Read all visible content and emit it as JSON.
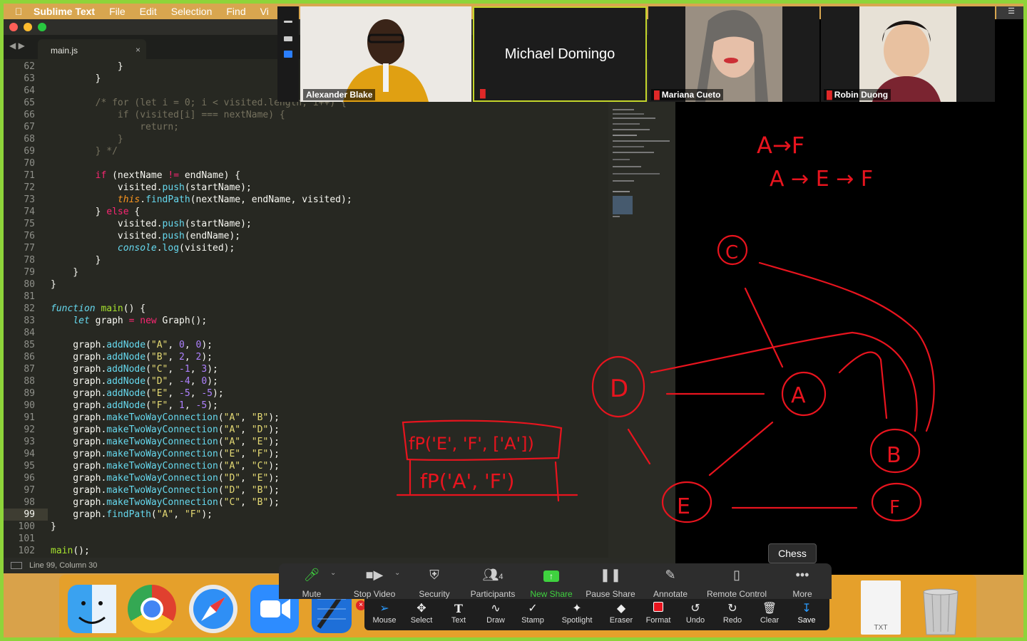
{
  "menubar": {
    "app_name": "Sublime Text",
    "items": [
      "File",
      "Edit",
      "Selection",
      "Find",
      "Vi"
    ]
  },
  "editor": {
    "tab_label": "main.js",
    "status": "Line 99, Column 30",
    "line_numbers": [
      "62",
      "63",
      "64",
      "65",
      "66",
      "67",
      "68",
      "69",
      "70",
      "71",
      "72",
      "73",
      "74",
      "75",
      "76",
      "77",
      "78",
      "79",
      "80",
      "81",
      "82",
      "83",
      "84",
      "85",
      "86",
      "87",
      "88",
      "89",
      "90",
      "91",
      "92",
      "93",
      "94",
      "95",
      "96",
      "97",
      "98",
      "99",
      "100",
      "101",
      "102"
    ]
  },
  "participants": {
    "p1": "Alexander Blake",
    "p2": "Michael Domingo",
    "p3": "Mariana Cueto",
    "p4": "Robin Duong"
  },
  "whiteboard": {
    "path_notes": [
      "A→F",
      "A → E → F"
    ],
    "nodes": [
      "C",
      "D",
      "A",
      "B",
      "E",
      "F"
    ],
    "stack_frames": [
      "fP('E', 'F', ['A'])",
      "fP('A', 'F')"
    ]
  },
  "tooltip": "Chess",
  "zoom_controls": [
    "Mute",
    "Stop Video",
    "Security",
    "Participants",
    "New Share",
    "Pause Share",
    "Annotate",
    "Remote Control",
    "More"
  ],
  "participants_count": "4",
  "annotation_tools": [
    "Mouse",
    "Select",
    "Text",
    "Draw",
    "Stamp",
    "Spotlight",
    "Eraser",
    "Format",
    "Undo",
    "Redo",
    "Clear",
    "Save"
  ],
  "dock": {
    "txt_label": "TXT"
  },
  "colors": {
    "accent_green": "#8ed43a",
    "annotation_red": "#e8141e",
    "new_share_green": "#3fd23f",
    "save_blue": "#2b9cff"
  }
}
